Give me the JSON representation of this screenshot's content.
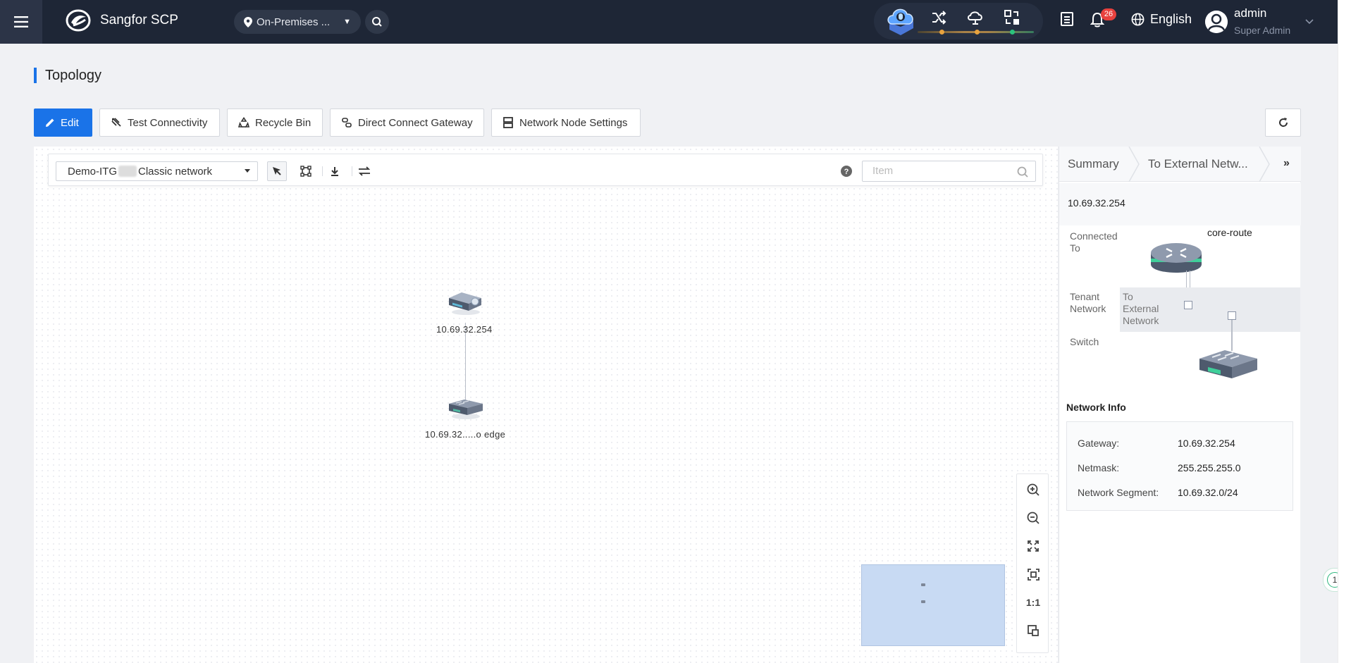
{
  "header": {
    "brand": "Sangfor SCP",
    "region": "On-Premises ...",
    "notification_count": "26",
    "language": "English",
    "user_name": "admin",
    "user_role": "Super Admin"
  },
  "page": {
    "title": "Topology"
  },
  "toolbar": {
    "edit": "Edit",
    "test_connectivity": "Test Connectivity",
    "recycle_bin": "Recycle Bin",
    "direct_connect_gateway": "Direct Connect Gateway",
    "network_node_settings": "Network Node Settings"
  },
  "canvas": {
    "network_select_prefix": "Demo-ITG",
    "network_select_suffix": "Classic network",
    "search_placeholder": "Item",
    "nodes": [
      {
        "label": "10.69.32.254",
        "type": "router"
      },
      {
        "label": "10.69.32.....o edge",
        "type": "switch"
      }
    ],
    "zoom_one_to_one": "1:1"
  },
  "right_panel": {
    "tab_summary": "Summary",
    "tab_external": "To External Netw...",
    "ip": "10.69.32.254",
    "connected_to_label": "Connected To",
    "core_route_label": "core-route",
    "tenant_network_label": "Tenant Network",
    "tenant_network_value": "To External Network",
    "switch_label": "Switch",
    "network_info_title": "Network Info",
    "network_info": {
      "gateway_label": "Gateway:",
      "gateway": "10.69.32.254",
      "netmask_label": "Netmask:",
      "netmask": "255.255.255.0",
      "segment_label": "Network Segment:",
      "segment": "10.69.32.0/24"
    }
  },
  "side_badge": "1",
  "colors": {
    "primary": "#1a73e8",
    "header_bg": "#1e2636",
    "badge": "#e8413e"
  }
}
